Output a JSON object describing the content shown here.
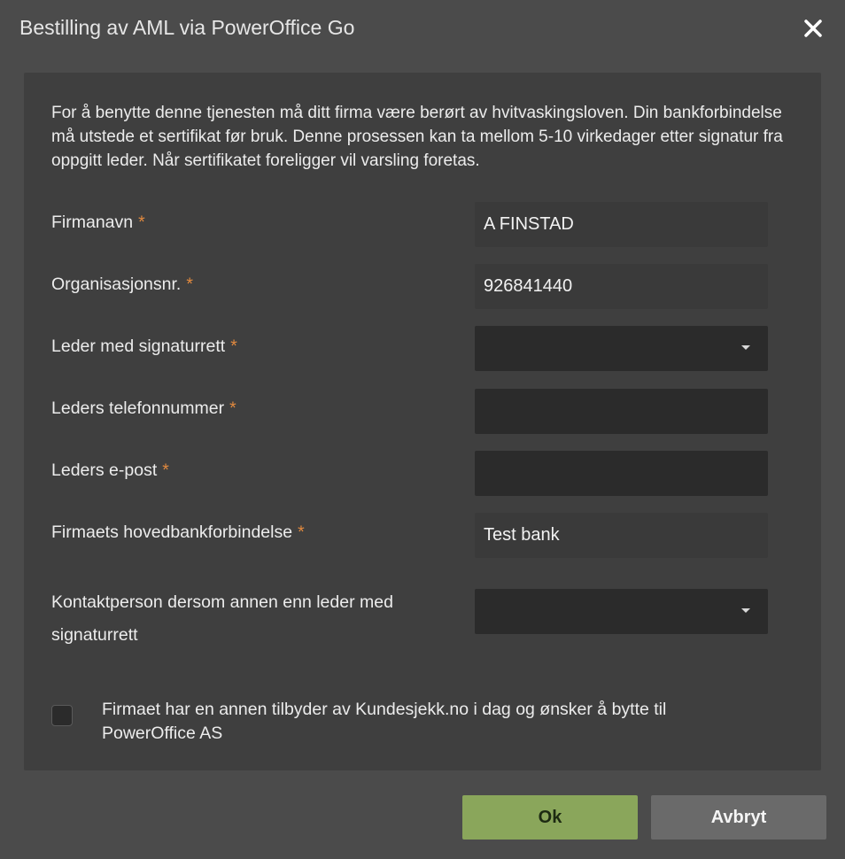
{
  "dialog": {
    "title": "Bestilling av AML via PowerOffice Go",
    "close_icon": "close-icon"
  },
  "intro": "For å benytte denne tjenesten må ditt firma være berørt av hvitvaskingsloven. Din bankforbindelse må utstede et sertifikat før bruk. Denne prosessen kan ta mellom 5-10 virkedager etter signatur fra oppgitt leder. Når sertifikatet foreligger vil varsling foretas.",
  "required_marker": "*",
  "fields": {
    "firmanavn": {
      "label": "Firmanavn",
      "value": "A FINSTAD"
    },
    "orgnr": {
      "label": "Organisasjonsnr.",
      "value": "926841440"
    },
    "leder": {
      "label": "Leder med signaturrett",
      "value": ""
    },
    "telefon": {
      "label": "Leders telefonnummer",
      "value": ""
    },
    "epost": {
      "label": "Leders e-post",
      "value": ""
    },
    "bank": {
      "label": "Firmaets hovedbankforbindelse",
      "value": "Test bank"
    },
    "kontakt": {
      "label_line1": "Kontaktperson dersom annen enn leder med",
      "label_line2": "signaturrett",
      "value": ""
    }
  },
  "switch_checkbox": {
    "checked": false,
    "label_line1": "Firmaet har en annen tilbyder av Kundesjekk.no i dag og ønsker å bytte til",
    "label_line2": "PowerOffice AS"
  },
  "buttons": {
    "ok": "Ok",
    "cancel": "Avbryt"
  },
  "colors": {
    "background": "#4b4b4b",
    "panel": "#3f3f3f",
    "required": "#e0893f",
    "ok_button": "#8aa65b",
    "cancel_button": "#6a6a6a"
  }
}
